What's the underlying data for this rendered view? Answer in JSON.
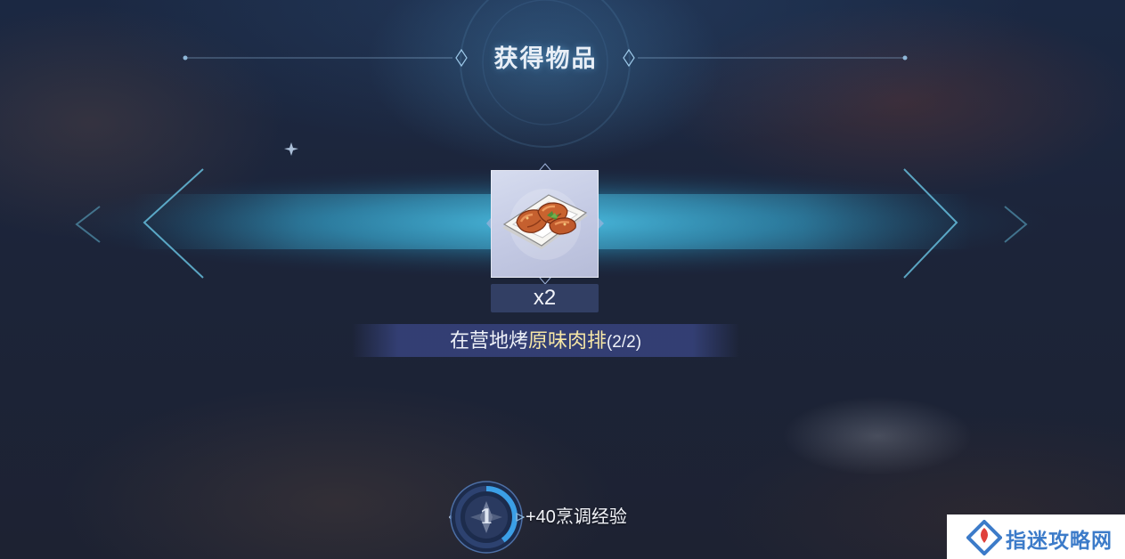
{
  "header": {
    "title": "获得物品"
  },
  "reward_item": {
    "icon": "grilled-meat-plate-icon",
    "quantity": "x2"
  },
  "task": {
    "prefix": "在营地烤",
    "highlight": "原味肉排",
    "progress": "(2/2)"
  },
  "experience": {
    "level": "1",
    "gain_text": "+40烹调经验",
    "progress_fraction": 0.4
  },
  "watermark": {
    "text": "指迷攻略网"
  },
  "colors": {
    "highlight": "#f6e6a6",
    "glow": "#3fb6e0",
    "watermark_blue": "#3c7bc9",
    "watermark_red": "#e0403a"
  }
}
